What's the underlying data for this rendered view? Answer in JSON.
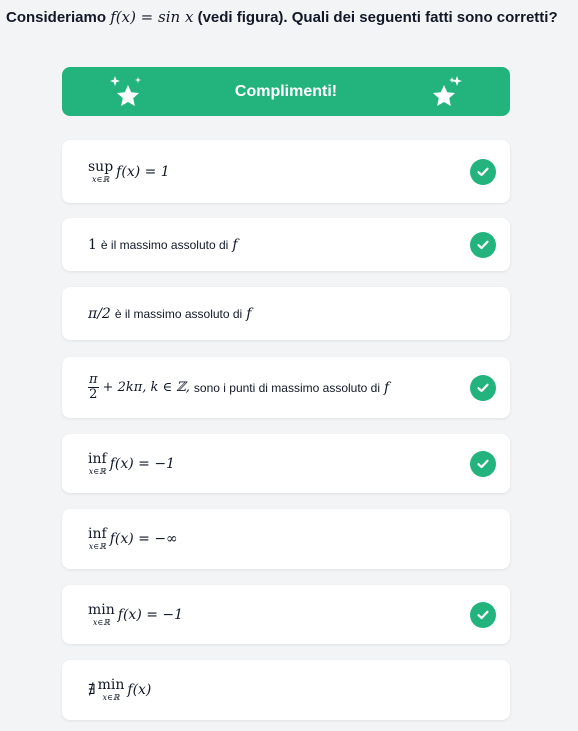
{
  "question": {
    "prefix": "Consideriamo",
    "function": "f(x) = sin x",
    "suffix": "(vedi figura). Quali dei seguenti fatti sono corretti?"
  },
  "banner": {
    "label": "Complimenti!",
    "icon": "sparkle-star-icon",
    "color": "#23b47e"
  },
  "options": [
    {
      "op": "sup",
      "sub": "x∈ℝ",
      "expr": "f(x) = 1",
      "text": "",
      "correct": true
    },
    {
      "expr": "1",
      "text": "è il massimo assoluto di",
      "var": "f",
      "correct": true
    },
    {
      "expr": "π/2",
      "text": "è il massimo assoluto di",
      "var": "f",
      "correct": false
    },
    {
      "num": "π",
      "den": "2",
      "expr": "+ 2kπ, k ∈ ℤ,",
      "text": "sono i punti di massimo assoluto di",
      "var": "f",
      "correct": true
    },
    {
      "op": "inf",
      "sub": "x∈ℝ",
      "expr": "f(x) = −1",
      "text": "",
      "correct": true
    },
    {
      "op": "inf",
      "sub": "x∈ℝ",
      "expr": "f(x) = −∞",
      "text": "",
      "correct": false
    },
    {
      "op": "min",
      "sub": "x∈ℝ",
      "expr": "f(x) = −1",
      "text": "",
      "correct": true
    },
    {
      "pre": "∄",
      "op": "min",
      "sub": "x∈ℝ",
      "expr": "f(x)",
      "text": "",
      "correct": false
    }
  ],
  "check_icon": "check-circle-icon"
}
